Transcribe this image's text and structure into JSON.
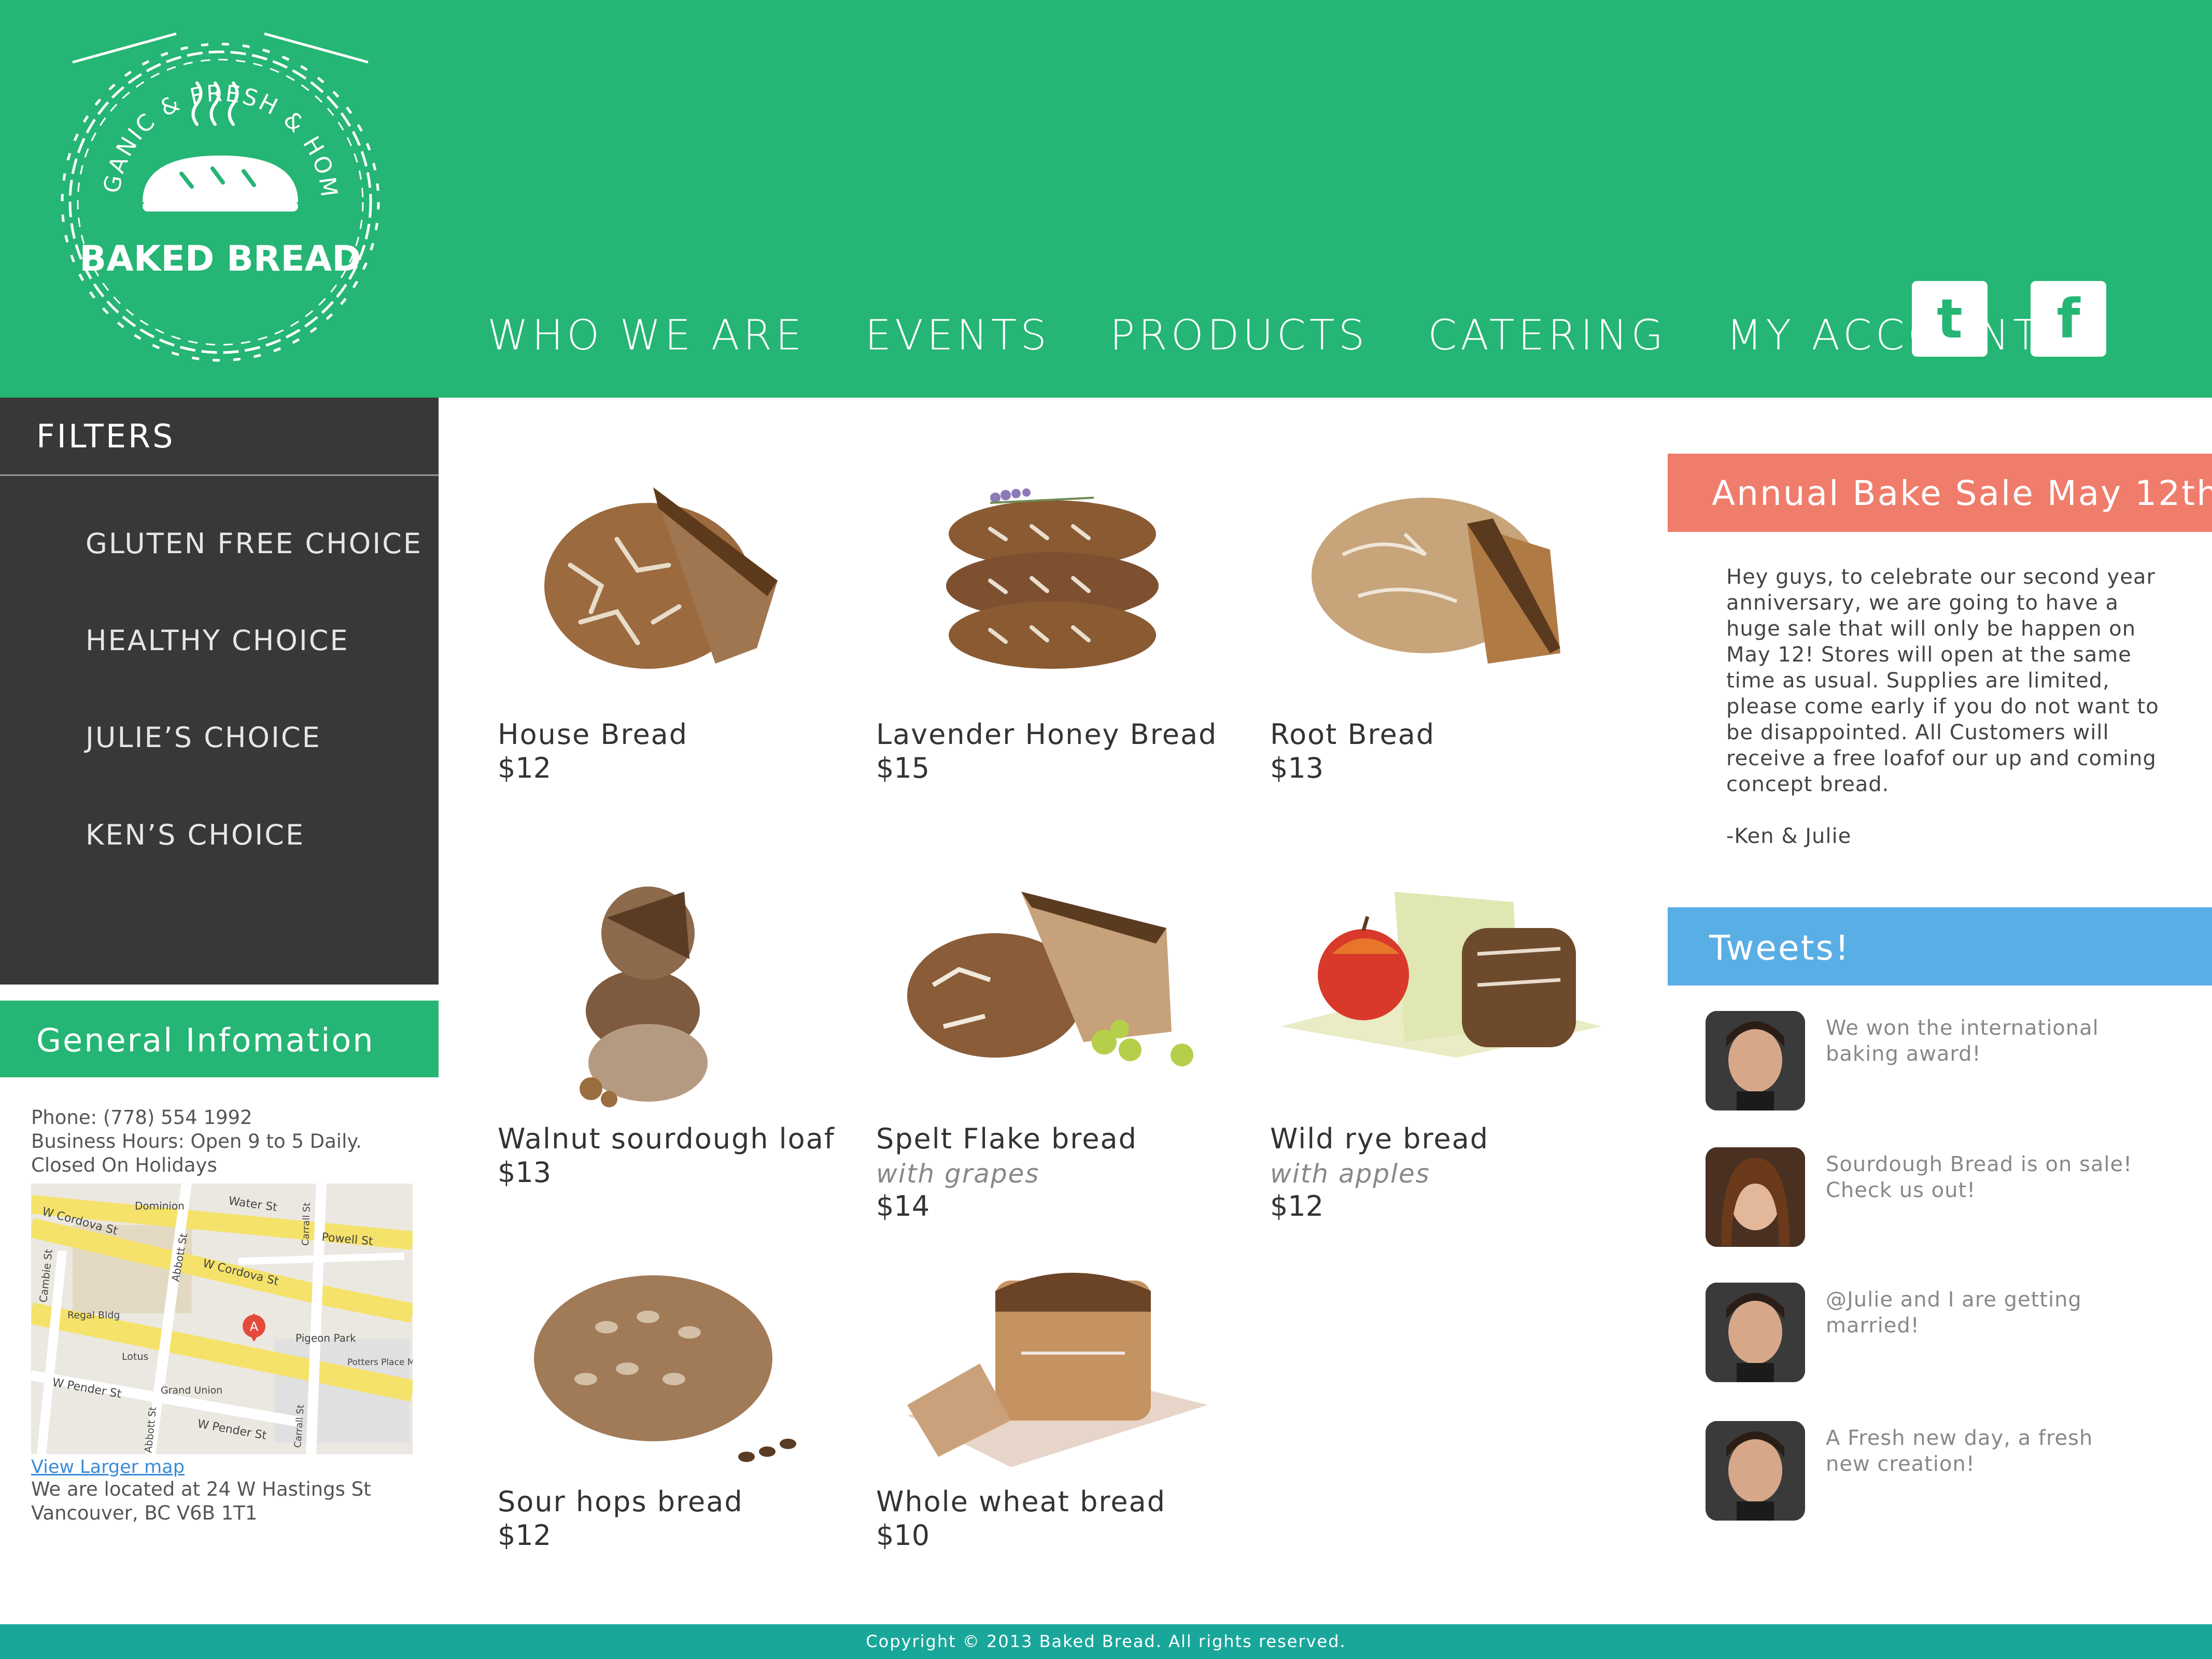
{
  "colors": {
    "header_green": "#25b574",
    "sidebar_dark": "#383838",
    "sale_salmon": "#f07c6c",
    "tweets_blue": "#5aaee6",
    "footer_teal": "#1aa79b"
  },
  "logo": {
    "arc_text": "ORGANIC & FRESH & HOMEY",
    "brand": "BAKED BREAD"
  },
  "nav": {
    "items": [
      "WHO WE ARE",
      "EVENTS",
      "PRODUCTS",
      "CATERING",
      "MY ACCOUNT"
    ]
  },
  "social": {
    "twitter_glyph": "t",
    "facebook_glyph": "f"
  },
  "filters": {
    "title": "FILTERS",
    "items": [
      "GLUTEN FREE CHOICE",
      "HEALTHY CHOICE",
      "JULIE’S CHOICE",
      "KEN’S CHOICE"
    ]
  },
  "general_info": {
    "title": "General Infomation",
    "phone": "Phone: (778) 554 1992",
    "hours": "Business Hours: Open 9 to 5 Daily.",
    "closed": "Closed On Holidays",
    "map_link": "View Larger map",
    "address_1": "We are located at 24 W Hastings St",
    "address_2": "Vancouver, BC V6B 1T1",
    "map_labels": [
      "Water St",
      "Dominion",
      "W Cordova St",
      "Powell St",
      "W Cordova St",
      "Abbott St",
      "Carrall St",
      "Cambie St",
      "Regal Bldg",
      "Pigeon Park",
      "Lotus",
      "Potters Place Mission",
      "W Pender St",
      "Grand Union",
      "W Pender St",
      "Abbott St",
      "Carrall St"
    ],
    "map_pin": "A"
  },
  "products": [
    {
      "name": "House Bread",
      "subtitle": "",
      "price": "$12"
    },
    {
      "name": "Lavender Honey Bread",
      "subtitle": "",
      "price": "$15"
    },
    {
      "name": "Root Bread",
      "subtitle": "",
      "price": "$13"
    },
    {
      "name": "Walnut sourdough loaf",
      "subtitle": "",
      "price": "$13"
    },
    {
      "name": "Spelt Flake bread",
      "subtitle": "with grapes",
      "price": "$14"
    },
    {
      "name": "Wild rye bread",
      "subtitle": "with apples",
      "price": "$12"
    },
    {
      "name": "Sour hops bread",
      "subtitle": "",
      "price": "$12"
    },
    {
      "name": "Whole wheat bread",
      "subtitle": "",
      "price": "$10"
    }
  ],
  "announcement": {
    "title": "Annual Bake Sale May 12th",
    "body": "Hey guys, to celebrate our second year anniversary, we are going to have a huge sale that will only be happen on May 12! Stores will open at the same time as usual. Supplies are limited, please come early if you do not want to be disappointed. All Customers will receive a free loafof our up and coming concept bread.",
    "signature": "-Ken & Julie"
  },
  "tweets": {
    "title": "Tweets!",
    "items": [
      {
        "text": "We won the international baking award!"
      },
      {
        "text": "Sourdough Bread is on sale! Check us out!"
      },
      {
        "text": "@Julie and I are getting married!"
      },
      {
        "text": "A Fresh new day, a fresh new creation!"
      }
    ]
  },
  "footer": {
    "copyright": "Copyright © 2013 Baked Bread. All rights reserved."
  }
}
